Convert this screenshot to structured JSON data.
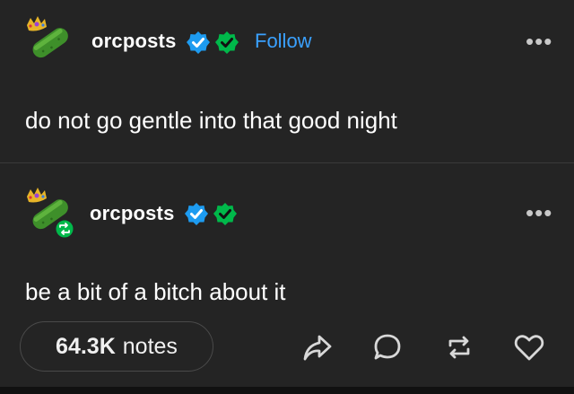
{
  "post1": {
    "username": "orcposts",
    "follow_label": "Follow",
    "body": "do not go gentle into that good night",
    "more_label": "•••"
  },
  "post2": {
    "username": "orcposts",
    "body": "be a bit of a bitch about it",
    "more_label": "•••",
    "reblogged": true
  },
  "footer": {
    "notes_count": "64.3K",
    "notes_label": "notes",
    "actions": [
      "share-icon",
      "reply-icon",
      "reblog-icon",
      "like-icon"
    ]
  },
  "colors": {
    "background": "#242424",
    "follow": "#3aa1ff",
    "verified_blue": "#1d9bf0",
    "verified_green": "#00b84a",
    "reblog_badge": "#00b84a"
  },
  "icons": {
    "avatar": "pickle-with-crown-avatar",
    "verified": "verified-badge-icon",
    "more": "more-options-icon"
  }
}
